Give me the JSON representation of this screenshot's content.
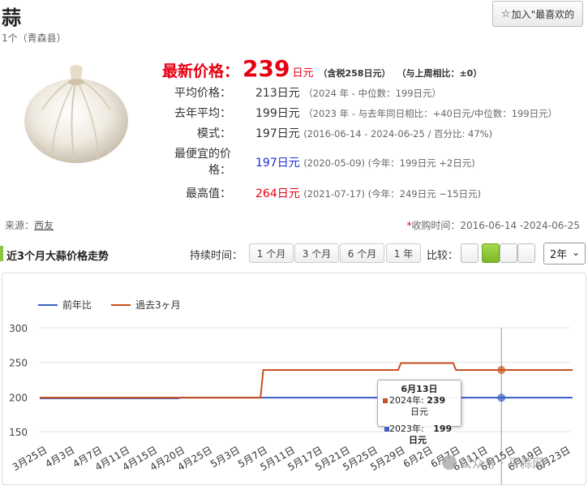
{
  "product": {
    "name": "蒜",
    "subtitle": "1个（青森县）"
  },
  "fav_button": {
    "label": "加入\"最喜欢的"
  },
  "latest": {
    "label": "最新价格：",
    "value": "239",
    "unit": "日元",
    "tax": "（含税258日元）",
    "compare": "（与上周相比：±0）"
  },
  "rows": {
    "avg": {
      "label": "平均价格：",
      "value": "213日元",
      "note": "（2024 年 - 中位数：199日元）"
    },
    "last_year": {
      "label": "去年平均：",
      "value": "199日元",
      "note_a": "（2023 年 - 与去年同日相比：",
      "note_b": "+40日元",
      "note_c": "/中位数：199日元）"
    },
    "mode": {
      "label": "模式：",
      "value": "197日元",
      "note": "(2016-06-14 - 2024-06-25 / 百分比: 47%)"
    },
    "cheapest": {
      "label_1": "最便宜的价",
      "label_2": "格：",
      "value": "197日元",
      "note_a": "(2020-05-09) (今年：199日元 ",
      "note_b": "+2日元",
      "note_c": ")"
    },
    "highest": {
      "label": "最高值：",
      "value": "264日元",
      "note_a": "(2021-07-17) (今年：249日元 ",
      "note_b": "~15日元",
      "note_c": ")"
    }
  },
  "source": {
    "label": "来源：",
    "link": "西友"
  },
  "collect": {
    "asterisk": "*",
    "text": "收购时间：2016-06-14 -2024-06-25"
  },
  "section_title": "近3个月大蒜价格走势",
  "duration": {
    "label": "持续时间：",
    "options": [
      "1 个月",
      "3 个月",
      "6 个月",
      "1 年"
    ]
  },
  "compare_label": "比较：",
  "year_select": {
    "value": "2年"
  },
  "colors": {
    "accent_red": "#e60012",
    "accent_green": "#8cc63f",
    "series_prev": "#3b5ec7",
    "series_3m": "#c8501e"
  },
  "tooltip": {
    "date": "6月13日",
    "line1_label": "2024年:",
    "line1_value": "239",
    "line1_unit": "日元",
    "line2_label": "2023年:",
    "line2_value": "199",
    "line2_unit": "日元"
  },
  "watermark": "公众号 · 平蒜网",
  "chart_data": {
    "type": "line",
    "ylim": [
      150,
      300
    ],
    "yticks": [
      150,
      200,
      250,
      300
    ],
    "grid": true,
    "legend_position": "top-left",
    "x_labels": [
      "3月25日",
      "4月3日",
      "4月7日",
      "4月11日",
      "4月15日",
      "4月20日",
      "4月25日",
      "5月3日",
      "5月7日",
      "5月11日",
      "5月17日",
      "5月21日",
      "5月25日",
      "5月29日",
      "6月2日",
      "6月7日",
      "6月11日",
      "6月15日",
      "6月19日",
      "6月23日"
    ],
    "series": [
      {
        "name": "前年比",
        "color": "#3b5ec7",
        "points": [
          [
            "3月25日",
            198
          ],
          [
            "4月3日",
            198
          ],
          [
            "4月7日",
            198
          ],
          [
            "4月11日",
            198
          ],
          [
            "4月15日",
            198
          ],
          [
            "4月20日",
            199
          ],
          [
            "4月25日",
            199
          ],
          [
            "5月3日",
            199
          ],
          [
            "5月7日",
            199
          ],
          [
            "5月11日",
            199
          ],
          [
            "5月17日",
            199
          ],
          [
            "5月21日",
            199
          ],
          [
            "5月25日",
            199
          ],
          [
            "5月29日",
            199
          ],
          [
            "6月2日",
            199
          ],
          [
            "6月7日",
            199
          ],
          [
            "6月11日",
            199
          ],
          [
            "6月15日",
            199
          ],
          [
            "6月19日",
            199
          ],
          [
            "6月23日",
            199
          ]
        ]
      },
      {
        "name": "過去3ヶ月",
        "color": "#c8501e",
        "points": [
          [
            "3月25日",
            199
          ],
          [
            "4月3日",
            199
          ],
          [
            "4月7日",
            199
          ],
          [
            "4月11日",
            199
          ],
          [
            "4月15日",
            199
          ],
          [
            "4月20日",
            199
          ],
          [
            "4月25日",
            199
          ],
          [
            "5月3日",
            199
          ],
          [
            "5月7日",
            239
          ],
          [
            "5月11日",
            239
          ],
          [
            "5月17日",
            239
          ],
          [
            "5月21日",
            239
          ],
          [
            "5月25日",
            239
          ],
          [
            "5月29日",
            249
          ],
          [
            "6月2日",
            249
          ],
          [
            "6月7日",
            239
          ],
          [
            "6月11日",
            239
          ],
          [
            "6月15日",
            239
          ],
          [
            "6月19日",
            239
          ],
          [
            "6月23日",
            239
          ]
        ]
      }
    ],
    "cursor_date": "6月13日"
  }
}
